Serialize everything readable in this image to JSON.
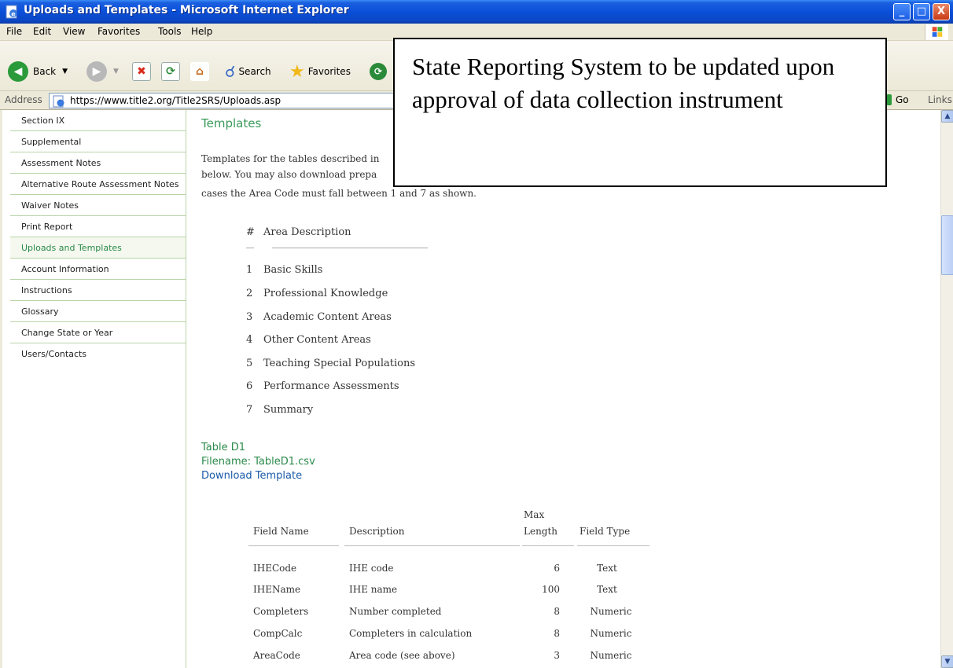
{
  "window": {
    "title": "Uploads and Templates - Microsoft Internet Explorer",
    "controls": {
      "minimize": "_",
      "maximize": "□",
      "close": "X"
    }
  },
  "menu": [
    "File",
    "Edit",
    "View",
    "Favorites",
    "Tools",
    "Help"
  ],
  "toolbar": {
    "back_label": "Back",
    "search_label": "Search",
    "favorites_label": "Favorites"
  },
  "address": {
    "label": "Address",
    "url": "https://www.title2.org/Title2SRS/Uploads.asp",
    "go_label": "Go",
    "links_label": "Links"
  },
  "sidebar": {
    "items": [
      {
        "label": "Section IX",
        "active": false
      },
      {
        "label": "Supplemental",
        "active": false
      },
      {
        "label": "Assessment Notes",
        "active": false
      },
      {
        "label": "Alternative Route Assessment Notes",
        "active": false
      },
      {
        "label": "Waiver Notes",
        "active": false
      },
      {
        "label": "Print Report",
        "active": false
      },
      {
        "label": "Uploads and Templates",
        "active": true
      },
      {
        "label": "Account Information",
        "active": false
      },
      {
        "label": "Instructions",
        "active": false
      },
      {
        "label": "Glossary",
        "active": false
      },
      {
        "label": "Change State or Year",
        "active": false
      },
      {
        "label": "Users/Contacts",
        "active": false
      }
    ]
  },
  "content": {
    "heading": "Templates",
    "intro_line1": "Templates for the tables described in",
    "intro_line2": "below. You may also download prepa",
    "intro_line3": "cases the Area Code must fall between 1 and 7 as shown.",
    "areas_header": {
      "num": "#",
      "desc": "Area Description"
    },
    "areas": [
      {
        "num": "1",
        "desc": "Basic Skills"
      },
      {
        "num": "2",
        "desc": "Professional Knowledge"
      },
      {
        "num": "3",
        "desc": "Academic Content Areas"
      },
      {
        "num": "4",
        "desc": "Other Content Areas"
      },
      {
        "num": "5",
        "desc": "Teaching Special Populations"
      },
      {
        "num": "6",
        "desc": "Performance Assessments"
      },
      {
        "num": "7",
        "desc": "Summary"
      }
    ],
    "table_name": "Table D1",
    "filename": "Filename: TableD1.csv",
    "download_link": "Download Template",
    "fields_header": {
      "name": "Field Name",
      "desc": "Description",
      "max_line1": "Max",
      "max_line2": "Length",
      "type": "Field Type"
    },
    "fields": [
      {
        "name": "IHECode",
        "desc": "IHE code",
        "max": "6",
        "type": "Text"
      },
      {
        "name": "IHEName",
        "desc": "IHE name",
        "max": "100",
        "type": "Text"
      },
      {
        "name": "Completers",
        "desc": "Number completed",
        "max": "8",
        "type": "Numeric"
      },
      {
        "name": "CompCalc",
        "desc": "Completers in calculation",
        "max": "8",
        "type": "Numeric"
      },
      {
        "name": "AreaCode",
        "desc": "Area code (see above)",
        "max": "3",
        "type": "Numeric"
      }
    ]
  },
  "callout": {
    "text": "State Reporting System to be updated upon approval of data collection instrument"
  }
}
